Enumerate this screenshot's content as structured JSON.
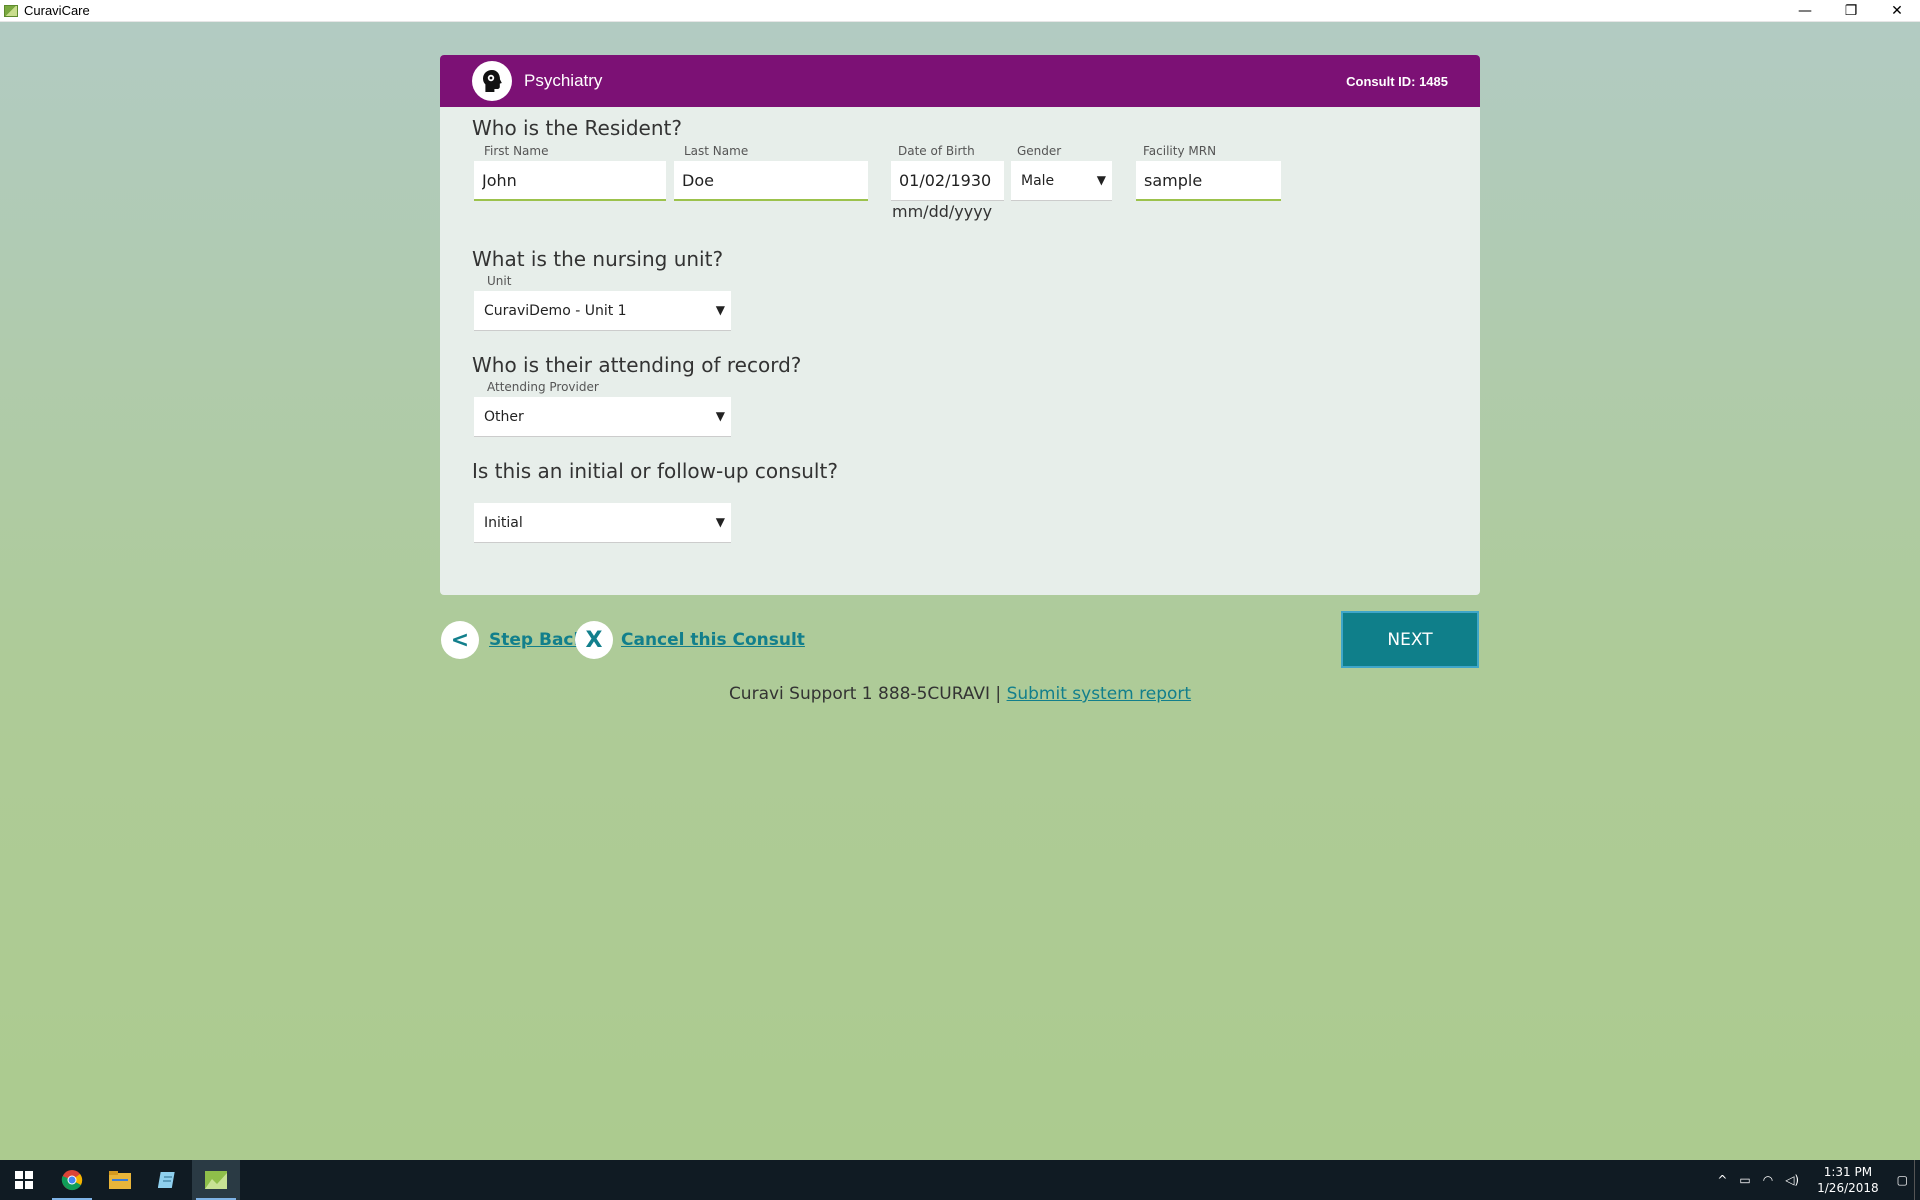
{
  "window": {
    "title": "CuraviCare",
    "controls": {
      "minimize": "—",
      "restore": "❐",
      "close": "✕"
    }
  },
  "header": {
    "department": "Psychiatry",
    "consult_id": "Consult ID: 1485",
    "icon": "head-profile-icon"
  },
  "resident": {
    "question": "Who is the Resident?",
    "first_name": {
      "label": "First Name",
      "value": "John"
    },
    "last_name": {
      "label": "Last Name",
      "value": "Doe"
    },
    "dob": {
      "label": "Date of Birth",
      "value": "01/02/1930",
      "hint": "mm/dd/yyyy"
    },
    "gender": {
      "label": "Gender",
      "value": "Male"
    },
    "mrn": {
      "label": "Facility MRN",
      "value": "sample"
    }
  },
  "unit": {
    "question": "What is the nursing unit?",
    "label": "Unit",
    "value": "CuraviDemo - Unit 1"
  },
  "attending": {
    "question": "Who is their attending of record?",
    "label": "Attending Provider",
    "value": "Other"
  },
  "consult_type": {
    "question": "Is this an initial or follow-up consult?",
    "value": "Initial"
  },
  "actions": {
    "step_back_symbol": "<",
    "step_back_label": "Step Back",
    "cancel_symbol": "X",
    "cancel_label": "Cancel this Consult",
    "next_label": "NEXT"
  },
  "support": {
    "text": "Curavi Support 1 888-5CURAVI | ",
    "report_link": "Submit system report"
  },
  "taskbar": {
    "items": [
      "windows-start-icon",
      "chrome-icon",
      "file-explorer-icon",
      "notepad-icon",
      "curavicare-icon"
    ],
    "time": "1:31 PM",
    "date": "1/26/2018"
  },
  "colors": {
    "header": "#7c1175",
    "accent": "#127f8c",
    "input_underline": "#9cc24c"
  }
}
